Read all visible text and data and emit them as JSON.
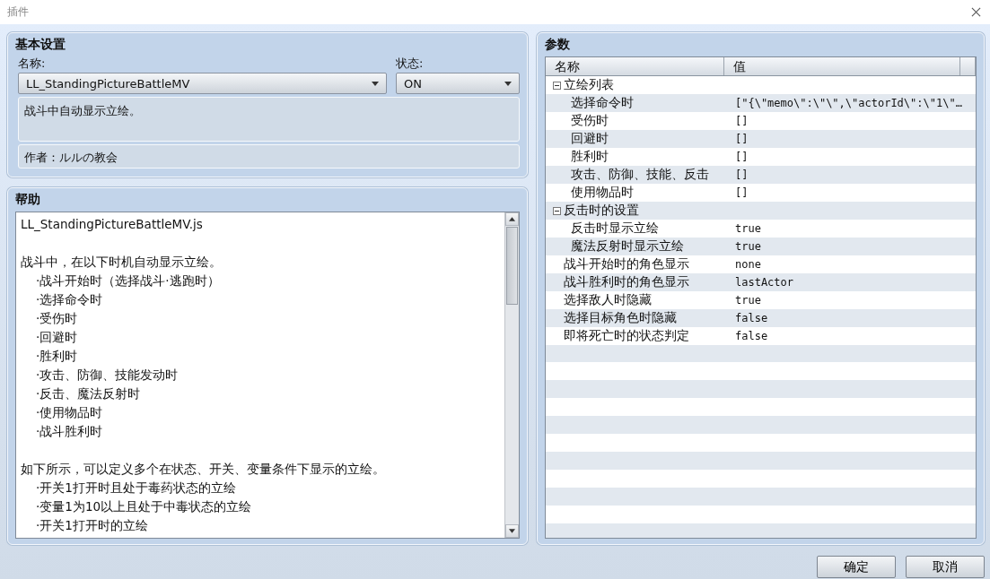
{
  "window": {
    "title": "插件"
  },
  "basic": {
    "title": "基本设置",
    "name_label": "名称:",
    "name_value": "LL_StandingPictureBattleMV",
    "status_label": "状态:",
    "status_value": "ON",
    "description": "战斗中自动显示立绘。",
    "author": "作者：ルルの教会"
  },
  "help": {
    "title": "帮助",
    "paragraphs": [
      {
        "lines": [
          {
            "kind": "text",
            "text": "LL_StandingPictureBattleMV.js"
          }
        ]
      },
      {
        "lines": [
          {
            "kind": "text",
            "text": "战斗中，在以下时机自动显示立绘。"
          },
          {
            "kind": "bullet",
            "text": "·战斗开始时（选择战斗·逃跑时）"
          },
          {
            "kind": "bullet",
            "text": "·选择命令时"
          },
          {
            "kind": "bullet",
            "text": "·受伤时"
          },
          {
            "kind": "bullet",
            "text": "·回避时"
          },
          {
            "kind": "bullet",
            "text": "·胜利时"
          },
          {
            "kind": "bullet",
            "text": "·攻击、防御、技能发动时"
          },
          {
            "kind": "bullet",
            "text": "·反击、魔法反射时"
          },
          {
            "kind": "bullet",
            "text": "·使用物品时"
          },
          {
            "kind": "bullet",
            "text": "·战斗胜利时"
          }
        ]
      },
      {
        "lines": [
          {
            "kind": "text",
            "text": "如下所示，可以定义多个在状态、开关、变量条件下显示的立绘。"
          },
          {
            "kind": "bullet",
            "text": "·开关1打开时且处于毒药状态的立绘"
          },
          {
            "kind": "bullet",
            "text": "·变量1为10以上且处于中毒状态的立绘"
          },
          {
            "kind": "bullet",
            "text": "·开关1打开时的立绘"
          }
        ]
      }
    ]
  },
  "parameters": {
    "title": "参数",
    "columns": [
      "名称",
      "值"
    ],
    "rows": [
      {
        "name": "立绘列表",
        "expanded": true,
        "children": [
          {
            "name": "选择命令时",
            "value": "[\"{\\\"memo\\\":\\\"\\\",\\\"actorId\\\":\\\"1\\\"…"
          },
          {
            "name": "受伤时",
            "value": "[]"
          },
          {
            "name": "回避时",
            "value": "[]"
          },
          {
            "name": "胜利时",
            "value": "[]"
          },
          {
            "name": "攻击、防御、技能、反击",
            "value": "[]"
          },
          {
            "name": "使用物品时",
            "value": "[]"
          }
        ]
      },
      {
        "name": "反击时的设置",
        "expanded": true,
        "children": [
          {
            "name": "反击时显示立绘",
            "value": "true"
          },
          {
            "name": "魔法反射时显示立绘",
            "value": "true"
          }
        ]
      },
      {
        "name": "战斗开始时的角色显示",
        "value": "none"
      },
      {
        "name": "战斗胜利时的角色显示",
        "value": "lastActor"
      },
      {
        "name": "选择敌人时隐藏",
        "value": "true"
      },
      {
        "name": "选择目标角色时隐藏",
        "value": "false"
      },
      {
        "name": "即将死亡时的状态判定",
        "value": "false"
      }
    ]
  },
  "buttons": [
    "确定",
    "取消"
  ]
}
